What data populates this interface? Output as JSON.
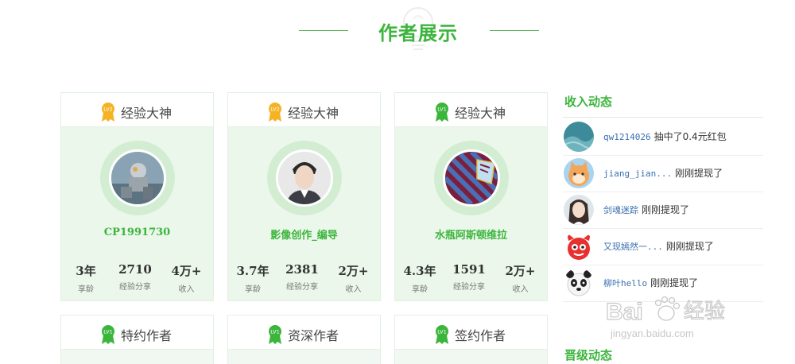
{
  "section": {
    "title": "作者展示"
  },
  "cards": [
    {
      "level_tag": "LV2",
      "level_name": "经验大神",
      "name": "CP1991730",
      "stats": [
        {
          "value": "3年",
          "label": "享龄"
        },
        {
          "value": "2710",
          "label": "经验分享"
        },
        {
          "value": "4万+",
          "label": "收入"
        }
      ]
    },
    {
      "level_tag": "LV2",
      "level_name": "经验大神",
      "name": "影像创作_编导",
      "stats": [
        {
          "value": "3.7年",
          "label": "享龄"
        },
        {
          "value": "2381",
          "label": "经验分享"
        },
        {
          "value": "2万+",
          "label": "收入"
        }
      ]
    },
    {
      "level_tag": "LV1",
      "level_name": "经验大神",
      "name": "水瓶阿斯顿维拉",
      "stats": [
        {
          "value": "4.3年",
          "label": "享龄"
        },
        {
          "value": "1591",
          "label": "经验分享"
        },
        {
          "value": "2万+",
          "label": "收入"
        }
      ]
    },
    {
      "level_tag": "LV1",
      "level_name": "特约作者"
    },
    {
      "level_tag": "LV1",
      "level_name": "资深作者"
    },
    {
      "level_tag": "LV1",
      "level_name": "签约作者"
    }
  ],
  "income_feed": {
    "title": "收入动态",
    "items": [
      {
        "user": "qw1214026",
        "action": "抽中了0.4元红包"
      },
      {
        "user": "jiang_jian...",
        "action": "刚刚提现了"
      },
      {
        "user": "剑魂迷踪",
        "action": "刚刚提现了"
      },
      {
        "user": "又现嫣然一...",
        "action": "刚刚提现了"
      },
      {
        "user": "柳叶hello",
        "action": "刚刚提现了"
      }
    ]
  },
  "promotion_feed": {
    "title": "晋级动态"
  },
  "watermark": {
    "brand": "Bai",
    "brand_cn": "经验",
    "url": "jingyan.baidu.com"
  },
  "colors": {
    "accent": "#3cb53c",
    "card_bg": "#eaf7ea",
    "ring": "#d3edd3",
    "gold": "#f5b324",
    "link": "#3a6fb0"
  }
}
